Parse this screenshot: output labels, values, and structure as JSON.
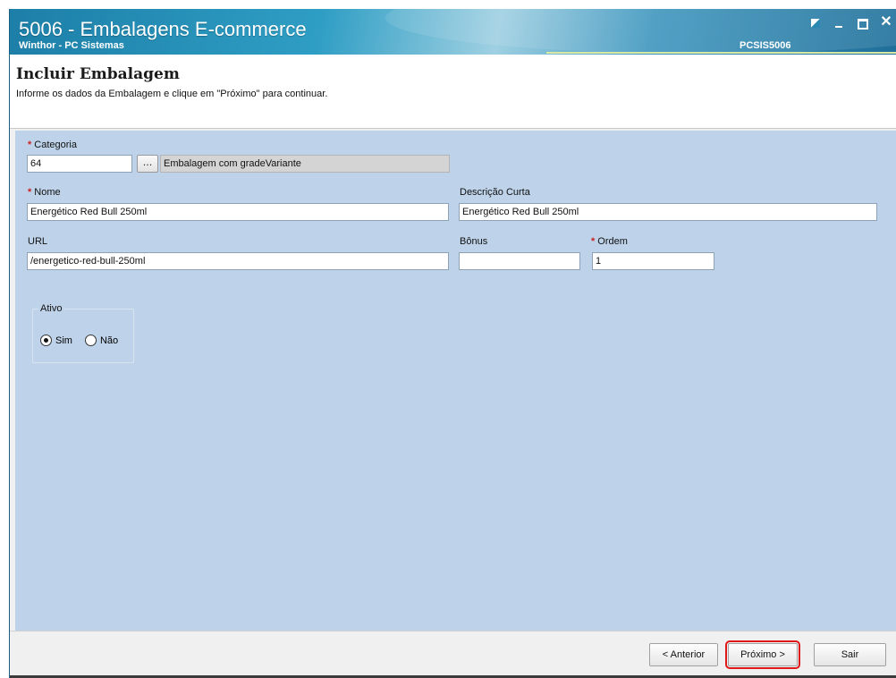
{
  "window": {
    "title": "5006 - Embalagens E-commerce",
    "subtitle": "Winthor - PC Sistemas",
    "code": "PCSIS5006"
  },
  "header": {
    "title": "Incluir Embalagem",
    "description": "Informe os dados da Embalagem e clique em \"Próximo\" para continuar."
  },
  "form": {
    "required_marker": "*",
    "categoria": {
      "label": "Categoria",
      "value": "64",
      "lookup_label": "...",
      "description": "Embalagem com gradeVariante"
    },
    "nome": {
      "label": "Nome",
      "value": "Energético Red Bull 250ml"
    },
    "descricao_curta": {
      "label": "Descrição Curta",
      "value": "Energético Red Bull 250ml"
    },
    "url": {
      "label": "URL",
      "value": "/energetico-red-bull-250ml"
    },
    "bonus": {
      "label": "Bônus",
      "value": ""
    },
    "ordem": {
      "label": "Ordem",
      "value": "1"
    },
    "ativo": {
      "label": "Ativo",
      "options": [
        {
          "label": "Sim",
          "selected": true
        },
        {
          "label": "Não",
          "selected": false
        }
      ]
    }
  },
  "footer": {
    "anterior": "< Anterior",
    "proximo": "Próximo >",
    "sair": "Sair"
  },
  "colors": {
    "titlebar": "#1d7fa8",
    "form_background": "#bed3ea",
    "required": "#cc2222",
    "highlight": "#e01818"
  }
}
